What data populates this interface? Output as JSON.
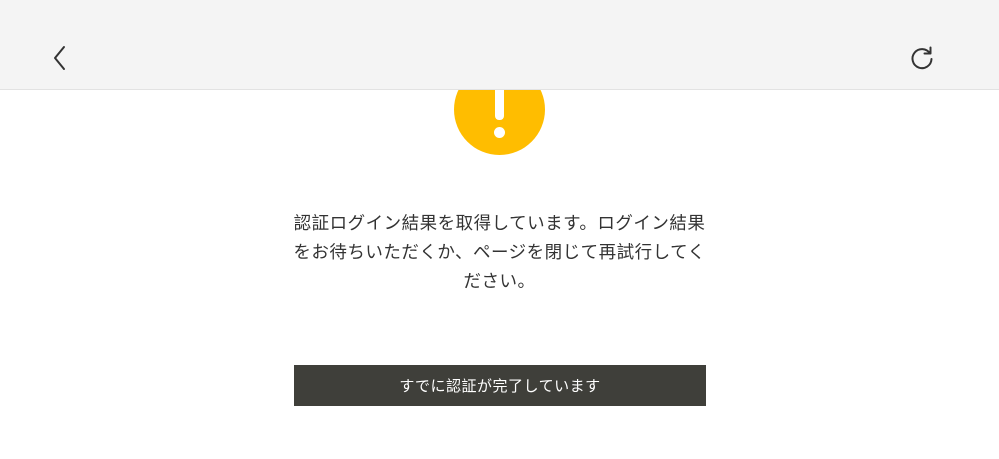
{
  "header": {
    "back_icon": "chevron-left-icon",
    "reload_icon": "reload-icon",
    "background_color": "#f4f4f4"
  },
  "status": {
    "icon": "warning-icon",
    "icon_color": "#ffbd00"
  },
  "message": {
    "lines": [
      "認証ログイン結果を取得しています。ログイン結果",
      "をお待ちいただくか、ページを閉じて再試行してく",
      "ださい。"
    ]
  },
  "actions": {
    "already_authenticated_label": "すでに認証が完了しています",
    "button_color": "#3f3f3a"
  }
}
